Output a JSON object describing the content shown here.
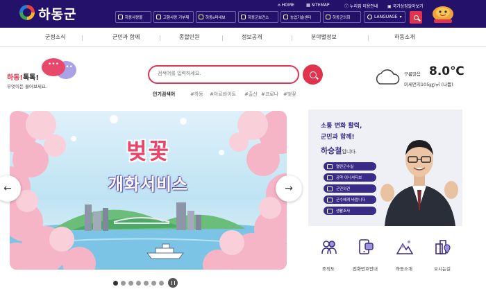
{
  "brand": {
    "name": "하동군",
    "mascot": "mascot-icon",
    "accent": "#e0344e",
    "header_bg": "#24126a"
  },
  "top_links": [
    {
      "label": "HOME"
    },
    {
      "label": "SITEMAP"
    },
    {
      "label": "누리집 이용안내"
    },
    {
      "label": "국가상징알아보기"
    }
  ],
  "quick_buttons": [
    {
      "label": "하동사랑몰"
    },
    {
      "label": "고향사랑 기부제"
    },
    {
      "label": "하동e마네보"
    },
    {
      "label": "하동군보건소"
    },
    {
      "label": "농업기술센터"
    },
    {
      "label": "하동군의회"
    }
  ],
  "language": {
    "label": "LANGUAGE"
  },
  "nav": [
    "군정소식",
    "군민과 함께",
    "종합민원",
    "정보공개",
    "분야별정보",
    "하동소개"
  ],
  "talk": {
    "title_red": "하동!",
    "title_dark": "톡톡!",
    "subtitle": "무엇이든 물어보세요."
  },
  "search": {
    "placeholder": "검색어를 입력하세요.",
    "popular_label": "인기검색어",
    "keywords": [
      "#하동",
      "#아르바이트",
      "#출산",
      "#코로나",
      "#벚꽃"
    ]
  },
  "weather": {
    "icon": "cloud-icon",
    "temp_label": "구름많음",
    "temperature": "8.0℃",
    "dust": "미세먼지105㎍/㎥ (나쁨)"
  },
  "banner": {
    "title": "벚꽃",
    "subtitle": "개화서비스",
    "prev": "←",
    "next": "→",
    "slide_count": 7,
    "active_slide": 1
  },
  "governor": {
    "line1": "소통 변화 활력,",
    "line2": "군민과 함께!",
    "name": "하승철",
    "name_suffix": "입니다.",
    "buttons": [
      "열린군수실",
      "공약 이니셔티브",
      "군민의견",
      "군수에게 바랍니다",
      "생활조사"
    ]
  },
  "quick_icons": [
    {
      "label": "조직도",
      "icon": "org-chart-icon"
    },
    {
      "label": "전화번호안내",
      "icon": "phone-directory-icon"
    },
    {
      "label": "하동소개",
      "icon": "mountain-icon"
    },
    {
      "label": "오시는길",
      "icon": "location-icon"
    }
  ]
}
